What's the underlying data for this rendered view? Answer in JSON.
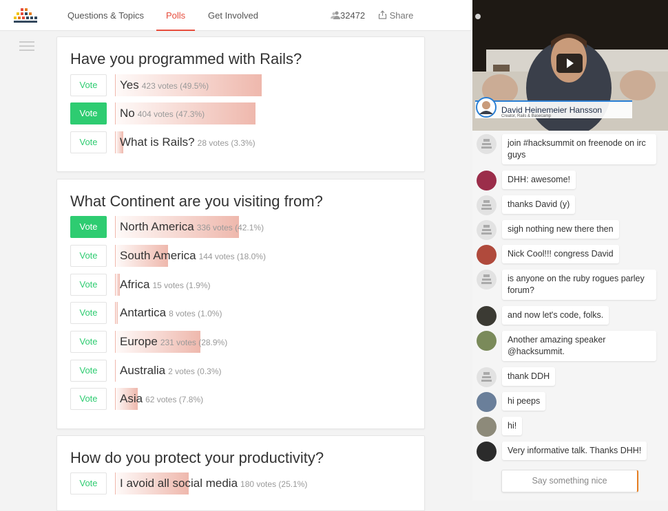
{
  "header": {
    "tabs": [
      {
        "label": "Questions & Topics",
        "active": false
      },
      {
        "label": "Polls",
        "active": true
      },
      {
        "label": "Get Involved",
        "active": false
      }
    ],
    "viewer_count": "32472",
    "share_label": "Share"
  },
  "polls": [
    {
      "question": "Have you programmed with Rails?",
      "options": [
        {
          "label": "Yes",
          "votes_text": "423 votes (49.5%)",
          "percent": 49.5,
          "voted": false
        },
        {
          "label": "No",
          "votes_text": "404 votes (47.3%)",
          "percent": 47.3,
          "voted": true
        },
        {
          "label": "What is Rails?",
          "votes_text": "28 votes (3.3%)",
          "percent": 3.3,
          "voted": false
        }
      ]
    },
    {
      "question": "What Continent are you visiting from?",
      "options": [
        {
          "label": "North America",
          "votes_text": "336 votes (42.1%)",
          "percent": 42.1,
          "voted": true
        },
        {
          "label": "South America",
          "votes_text": "144 votes (18.0%)",
          "percent": 18.0,
          "voted": false
        },
        {
          "label": "Africa",
          "votes_text": "15 votes (1.9%)",
          "percent": 1.9,
          "voted": false
        },
        {
          "label": "Antartica",
          "votes_text": "8 votes (1.0%)",
          "percent": 1.0,
          "voted": false
        },
        {
          "label": "Europe",
          "votes_text": "231 votes (28.9%)",
          "percent": 28.9,
          "voted": false
        },
        {
          "label": "Australia",
          "votes_text": "2 votes (0.3%)",
          "percent": 0.3,
          "voted": false
        },
        {
          "label": "Asia",
          "votes_text": "62 votes (7.8%)",
          "percent": 7.8,
          "voted": false
        }
      ]
    },
    {
      "question": "How do you protect your productivity?",
      "options": [
        {
          "label": "I avoid all social media",
          "votes_text": "180 votes (25.1%)",
          "percent": 25.1,
          "voted": false
        }
      ]
    }
  ],
  "vote_label": "Vote",
  "video": {
    "speaker_name": "David Heinemeier Hansson",
    "speaker_title": "Creator, Rails & Basecamp"
  },
  "chat": {
    "messages": [
      {
        "text": "join #hacksummit on freenode on irc guys",
        "avatar": "generic"
      },
      {
        "text": "DHH: awesome!",
        "avatar": "photo",
        "color": "#9b2d4a"
      },
      {
        "text": "thanks David (y)",
        "avatar": "generic"
      },
      {
        "text": "sigh nothing new there then",
        "avatar": "generic"
      },
      {
        "text": "Nick Cool!!! congress David",
        "avatar": "photo",
        "color": "#b04a3c"
      },
      {
        "text": "is anyone on the ruby rogues parley forum?",
        "avatar": "generic"
      },
      {
        "text": "and now let's code, folks.",
        "avatar": "photo",
        "color": "#3b3a33"
      },
      {
        "text": "Another amazing speaker @hacksummit.",
        "avatar": "photo",
        "color": "#7a8a5a"
      },
      {
        "text": "thank DDH",
        "avatar": "generic"
      },
      {
        "text": "hi peeps",
        "avatar": "photo",
        "color": "#6a7f9a"
      },
      {
        "text": "hi!",
        "avatar": "photo",
        "color": "#8d8a7a"
      },
      {
        "text": "Very informative talk. Thanks DHH!",
        "avatar": "photo",
        "color": "#2b2b2b"
      }
    ],
    "input_placeholder": "Say something nice"
  }
}
